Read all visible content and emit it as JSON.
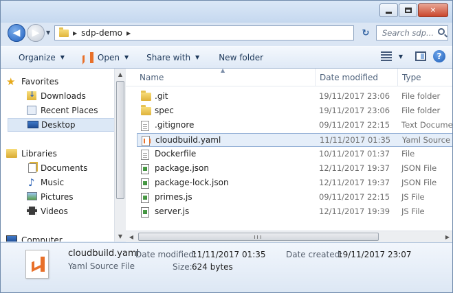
{
  "window": {
    "controls": {
      "minimize": "minimize",
      "maximize": "maximize",
      "close": "✕"
    }
  },
  "address": {
    "crumb": "sdp-demo",
    "search_placeholder": "Search sdp..."
  },
  "toolbar": {
    "organize": "Organize",
    "open": "Open",
    "share_with": "Share with",
    "new_folder": "New folder"
  },
  "nav": {
    "favorites": "Favorites",
    "downloads": "Downloads",
    "recent_places": "Recent Places",
    "desktop": "Desktop",
    "libraries": "Libraries",
    "documents": "Documents",
    "music": "Music",
    "pictures": "Pictures",
    "videos": "Videos",
    "computer": "Computer"
  },
  "columns": {
    "name": "Name",
    "date": "Date modified",
    "type": "Type"
  },
  "files": [
    {
      "name": ".git",
      "date": "19/11/2017 23:06",
      "type": "File folder",
      "icon": "folder-icon"
    },
    {
      "name": "spec",
      "date": "19/11/2017 23:06",
      "type": "File folder",
      "icon": "folder-icon"
    },
    {
      "name": ".gitignore",
      "date": "09/11/2017 22:15",
      "type": "Text Document",
      "icon": "text-file-icon"
    },
    {
      "name": "cloudbuild.yaml",
      "date": "11/11/2017 01:35",
      "type": "Yaml Source File",
      "icon": "vs-file-icon"
    },
    {
      "name": "Dockerfile",
      "date": "10/11/2017 01:37",
      "type": "File",
      "icon": "file-icon"
    },
    {
      "name": "package.json",
      "date": "12/11/2017 19:37",
      "type": "JSON File",
      "icon": "json-file-icon"
    },
    {
      "name": "package-lock.json",
      "date": "12/11/2017 19:37",
      "type": "JSON File",
      "icon": "json-file-icon"
    },
    {
      "name": "primes.js",
      "date": "09/11/2017 22:15",
      "type": "JS File",
      "icon": "js-file-icon"
    },
    {
      "name": "server.js",
      "date": "12/11/2017 19:39",
      "type": "JS File",
      "icon": "js-file-icon"
    }
  ],
  "details": {
    "filename": "cloudbuild.yaml",
    "filetype": "Yaml Source File",
    "date_modified_label": "Date modified:",
    "date_modified": "11/11/2017 01:35",
    "date_created_label": "Date created:",
    "date_created": "19/11/2017 23:07",
    "size_label": "Size:",
    "size": "624 bytes"
  },
  "colors": {
    "accent": "#e8702a",
    "selection": "#e5eef9",
    "folder": "#e0b43a"
  }
}
